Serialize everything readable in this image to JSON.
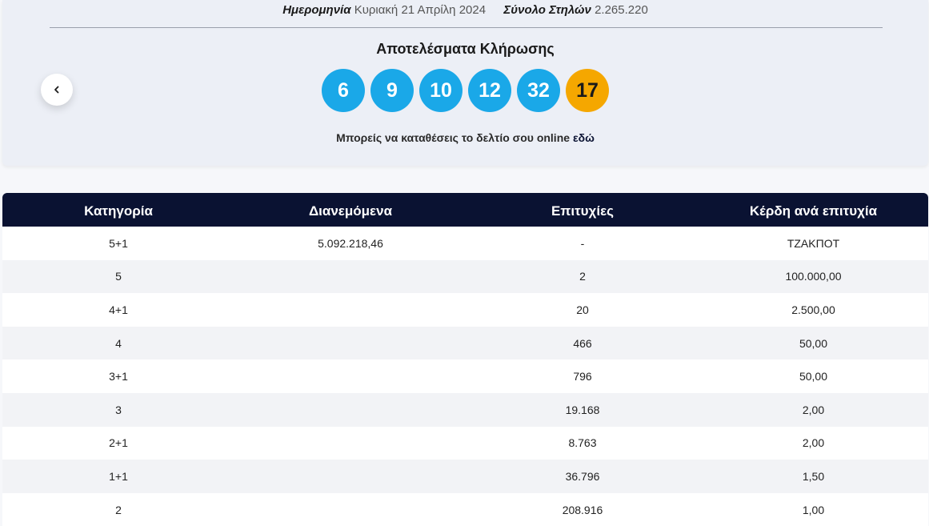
{
  "draw": {
    "date_label": "Ημερομηνία",
    "date_value": "Κυριακή 21 Απρίλη 2024",
    "columns_label": "Σύνολο Στηλών",
    "columns_value": "2.265.220",
    "title": "Αποτελέσματα Κλήρωσης",
    "numbers": [
      "6",
      "9",
      "10",
      "12",
      "32"
    ],
    "bonus": "17",
    "cta_text": "Μπορείς να καταθέσεις το δελτίο σου online",
    "cta_link": "εδώ",
    "colors": {
      "main_ball": "#1aa8e8",
      "bonus_ball": "#f5a700",
      "header_bg": "#0a1232"
    }
  },
  "nav": {
    "prev_icon": "chevron-left-icon"
  },
  "table": {
    "headers": [
      "Κατηγορία",
      "Διανεμόμενα",
      "Επιτυχίες",
      "Κέρδη ανά επιτυχία"
    ],
    "rows": [
      [
        "5+1",
        "5.092.218,46",
        "-",
        "ΤΖΑΚΠΟΤ"
      ],
      [
        "5",
        "",
        "2",
        "100.000,00"
      ],
      [
        "4+1",
        "",
        "20",
        "2.500,00"
      ],
      [
        "4",
        "",
        "466",
        "50,00"
      ],
      [
        "3+1",
        "",
        "796",
        "50,00"
      ],
      [
        "3",
        "",
        "19.168",
        "2,00"
      ],
      [
        "2+1",
        "",
        "8.763",
        "2,00"
      ],
      [
        "1+1",
        "",
        "36.796",
        "1,50"
      ],
      [
        "2",
        "",
        "208.916",
        "1,00"
      ]
    ]
  }
}
